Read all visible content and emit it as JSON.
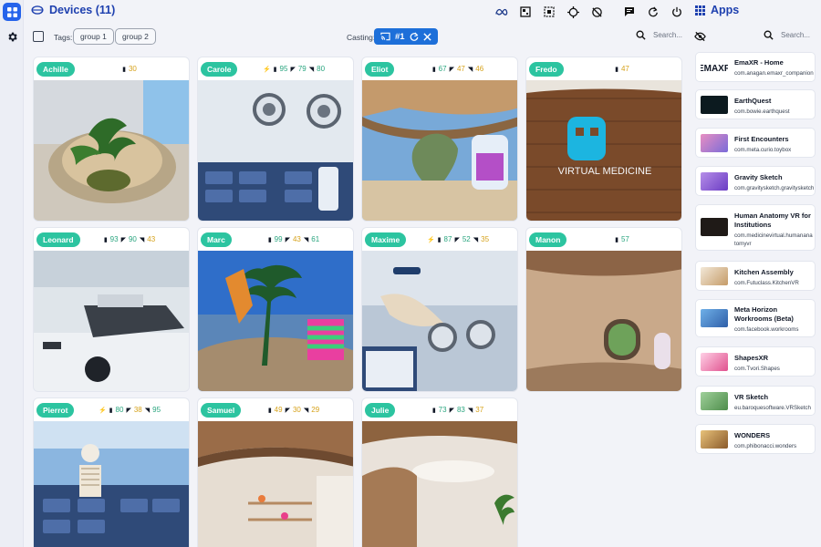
{
  "header": {
    "title": "Devices (11)",
    "apps_title": "Apps"
  },
  "toolbar": {
    "tags_label": "Tags:",
    "tags": [
      "group 1",
      "group 2"
    ],
    "casting_label": "Casting:",
    "casting_value": "#1",
    "search_placeholder": "Search..."
  },
  "app_search_placeholder": "Search...",
  "devices": [
    {
      "name": "Achille",
      "bolt": false,
      "battery": "30",
      "b_color": "yellow",
      "v1": null,
      "v2": null,
      "scene": "plant"
    },
    {
      "name": "Carole",
      "bolt": true,
      "battery": "95",
      "b_color": "green",
      "v1": "79",
      "v2": "80",
      "scene": "lab"
    },
    {
      "name": "Eliot",
      "bolt": false,
      "battery": "67",
      "b_color": "green",
      "v1": "47",
      "v2": "46",
      "scene": "lounge"
    },
    {
      "name": "Fredo",
      "bolt": false,
      "battery": "47",
      "b_color": "yellow",
      "v1": null,
      "v2": null,
      "scene": "medicine"
    },
    {
      "name": "Leonard",
      "bolt": false,
      "battery": "93",
      "b_color": "green",
      "v1": "90",
      "v2": "43",
      "scene": "bench"
    },
    {
      "name": "Marc",
      "bolt": false,
      "battery": "99",
      "b_color": "green",
      "v1": "43",
      "v2": "61",
      "scene": "beach"
    },
    {
      "name": "Maxime",
      "bolt": true,
      "battery": "87",
      "b_color": "green",
      "v1": "52",
      "v2": "35",
      "scene": "bone"
    },
    {
      "name": "Manon",
      "bolt": false,
      "battery": "57",
      "b_color": "green",
      "v1": null,
      "v2": null,
      "scene": "room"
    },
    {
      "name": "Pierrot",
      "bolt": true,
      "battery": "80",
      "b_color": "green",
      "v1": "38",
      "v2": "95",
      "scene": "skeleton"
    },
    {
      "name": "Samuel",
      "bolt": false,
      "battery": "49",
      "b_color": "yellow",
      "v1": "30",
      "v2": "29",
      "scene": "shelves"
    },
    {
      "name": "Julie",
      "bolt": false,
      "battery": "73",
      "b_color": "green",
      "v1": "83",
      "v2": "37",
      "scene": "hall"
    }
  ],
  "apps": [
    {
      "name": "EmaXR - Home",
      "package": "com.anagan.emaxr_companion",
      "thumb": "emaxr"
    },
    {
      "name": "EarthQuest",
      "package": "com.bowie.earthquest",
      "thumb": "dark"
    },
    {
      "name": "First Encounters",
      "package": "com.meta.curio.toybox",
      "thumb": "pink"
    },
    {
      "name": "Gravity Sketch",
      "package": "com.gravitysketch.gravitysketch",
      "thumb": "purple"
    },
    {
      "name": "Human Anatomy VR for Institutions",
      "package": "com.medicinevirtual.humananatomyvr",
      "thumb": "dark"
    },
    {
      "name": "Kitchen Assembly",
      "package": "com.Futuclass.KitchenVR",
      "thumb": "kitchen"
    },
    {
      "name": "Meta Horizon Workrooms (Beta)",
      "package": "com.facebook.workrooms",
      "thumb": "workrooms"
    },
    {
      "name": "ShapesXR",
      "package": "com.Tvori.Shapes",
      "thumb": "shapes"
    },
    {
      "name": "VR Sketch",
      "package": "eu.baroquesoftware.VRSketch",
      "thumb": "vrsketch"
    },
    {
      "name": "WONDERS",
      "package": "com.phibonacci.wonders",
      "thumb": "wonders"
    }
  ],
  "colors": {
    "accent": "#1e40af",
    "name_badge": "#2cc4a0",
    "cast_chip": "#1d6fd9"
  }
}
